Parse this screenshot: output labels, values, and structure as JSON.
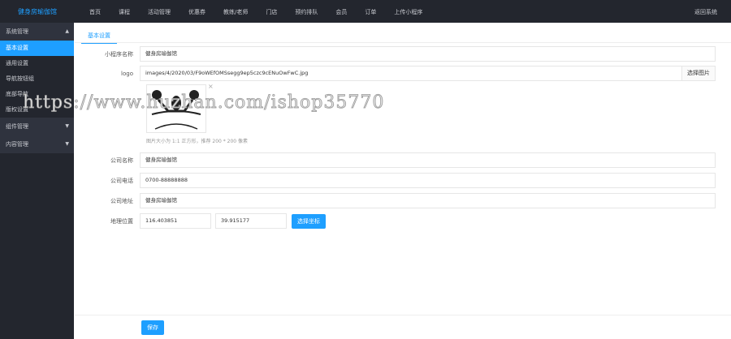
{
  "header": {
    "brand": "健身房瑜伽馆",
    "nav": [
      "首页",
      "课程",
      "活动管理",
      "优惠券",
      "教练/老师",
      "门店",
      "预约排队",
      "会员",
      "订单",
      "上传小程序"
    ],
    "back": "返回系统"
  },
  "sidebar": {
    "groups": [
      {
        "label": "系统管理",
        "expanded": true,
        "items": [
          "基本设置",
          "通用设置",
          "导航按钮组",
          "底部导航",
          "版权设置"
        ],
        "active": 0
      },
      {
        "label": "组件管理",
        "expanded": false
      },
      {
        "label": "内容管理",
        "expanded": false
      }
    ]
  },
  "main": {
    "tab": "基本设置",
    "fields": {
      "app_name": {
        "label": "小程序名称",
        "value": "健身房瑜伽馆"
      },
      "logo": {
        "label": "logo",
        "value": "images/4/2020/03/F9oWEfOMSsegg9ep5czc9cENuOwFwC.jpg",
        "pick": "选择图片",
        "hint": "图片大小为 1:1 正方形，推荐 200 * 200 像素"
      },
      "company": {
        "label": "公司名称",
        "value": "健身房瑜伽馆"
      },
      "phone": {
        "label": "公司电话",
        "value": "0700-88888888"
      },
      "address": {
        "label": "公司地址",
        "value": "健身房瑜伽馆"
      },
      "location": {
        "label": "地理位置",
        "lng": "116.403851",
        "lat": "39.915177",
        "pick": "选择坐标"
      }
    },
    "save": "保存"
  },
  "watermark": "https://www.huzhan.com/ishop35770",
  "colors": {
    "accent": "#1e9fff",
    "topbar": "#23262e"
  }
}
